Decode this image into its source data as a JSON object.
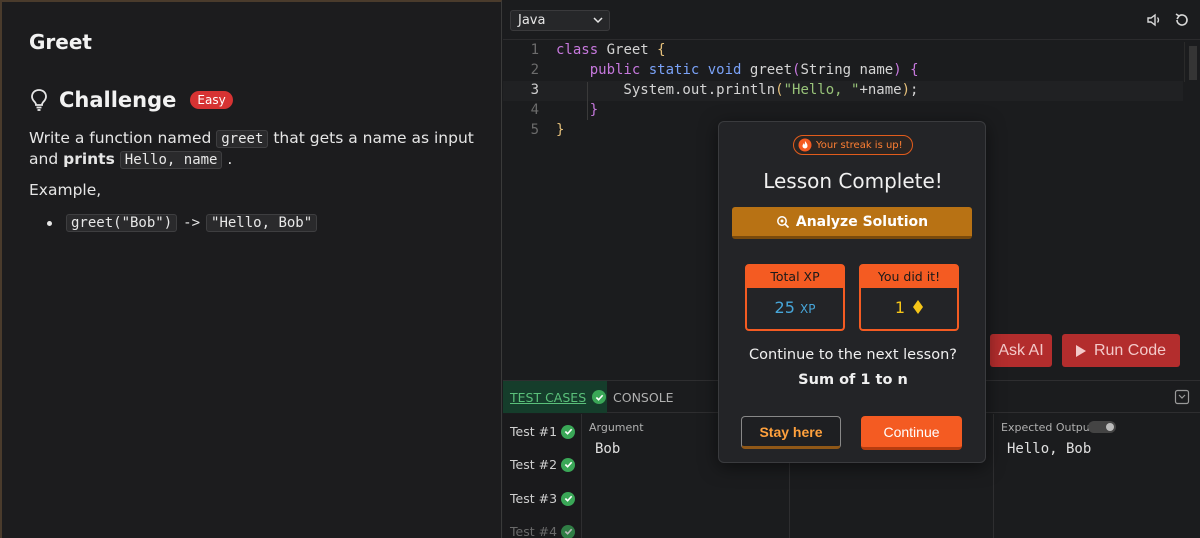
{
  "problem": {
    "title": "Greet",
    "challenge_label": "Challenge",
    "difficulty": "Easy",
    "desc_part1": "Write a function named ",
    "desc_code1": "greet",
    "desc_part2": " that gets a name as input and ",
    "desc_bold": "prints",
    "desc_code2": "Hello, name",
    "desc_part3": " .",
    "example_label": "Example,",
    "example_input": "greet(\"Bob\")",
    "example_arrow": "->",
    "example_output": "\"Hello, Bob\""
  },
  "editor": {
    "language": "Java",
    "line_numbers": [
      "1",
      "2",
      "3",
      "4",
      "5"
    ],
    "ask_ai_label": "Ask AI",
    "run_code_label": "Run Code"
  },
  "bottom": {
    "tab_test_cases": "TEST CASES",
    "tab_console": "CONSOLE",
    "tests": [
      "Test #1",
      "Test #2",
      "Test #3",
      "Test #4"
    ],
    "argument_label": "Argument",
    "argument_value": "Bob",
    "expected_label": "Expected Output",
    "expected_value": "Hello, Bob"
  },
  "modal": {
    "streak": "Your streak is up!",
    "title": "Lesson Complete!",
    "analyze_label": "Analyze Solution",
    "xp_header": "Total XP",
    "xp_value": "25",
    "xp_unit": "XP",
    "did_it_header": "You did it!",
    "did_it_value": "1",
    "next_question": "Continue to the next lesson?",
    "next_lesson": "Sum of 1 to n",
    "stay_label": "Stay here",
    "continue_label": "Continue"
  },
  "colors": {
    "accent_orange": "#f45b22",
    "analyze_gold": "#b87214",
    "run_red": "#b32d2d",
    "success_green": "#3aa757"
  }
}
